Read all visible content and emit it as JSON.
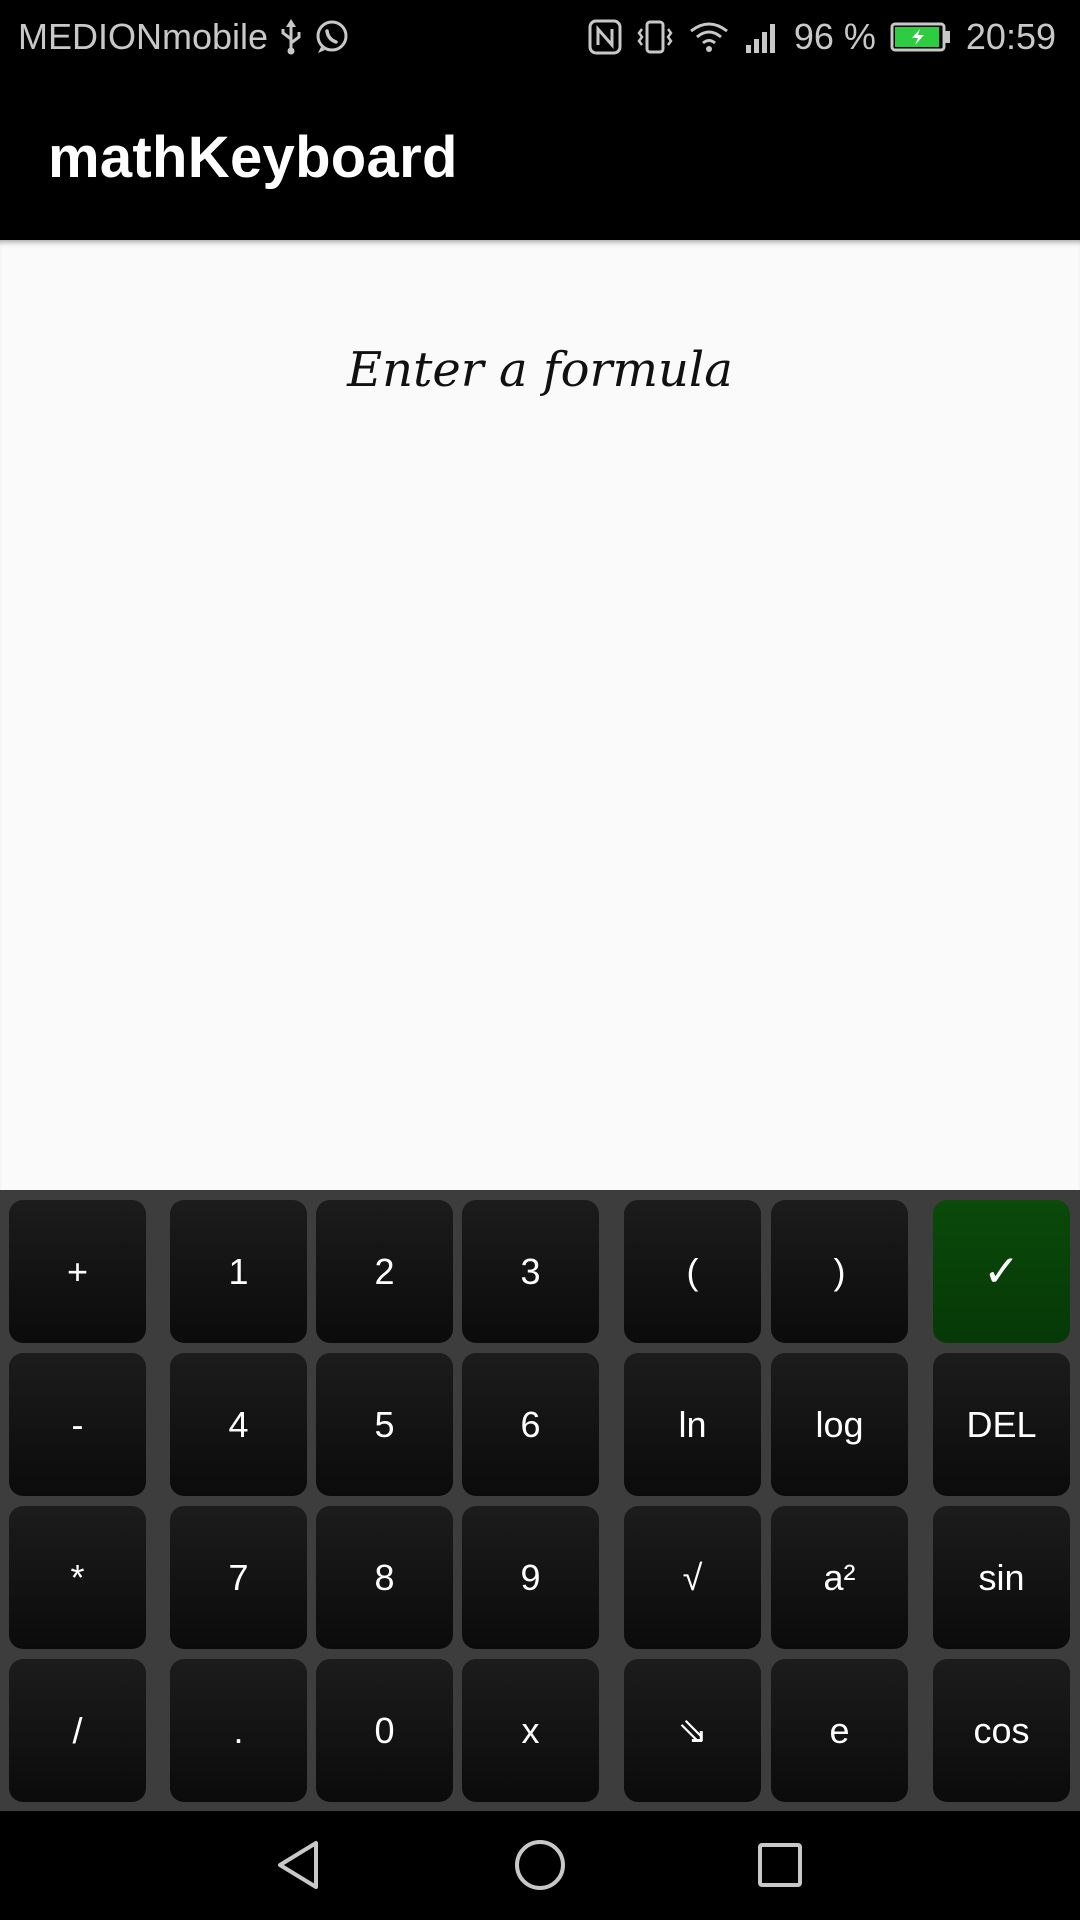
{
  "status_bar": {
    "carrier": "MEDIONmobile",
    "battery_percent": "96 %",
    "time": "20:59",
    "battery_level": 0.96,
    "battery_color": "#2ecc40",
    "icons_left": [
      "usb-icon",
      "whatsapp-icon"
    ],
    "icons_right": [
      "nfc-icon",
      "vibrate-icon",
      "wifi-icon",
      "signal-icon",
      "battery-icon"
    ]
  },
  "app_bar": {
    "title": "mathKeyboard"
  },
  "content": {
    "placeholder": "Enter a formula"
  },
  "keyboard": {
    "background": "#3d3d3d",
    "accent_color": "#063806",
    "rows": [
      [
        "+",
        "1",
        "2",
        "3",
        "(",
        ")",
        "✓"
      ],
      [
        "-",
        "4",
        "5",
        "6",
        "ln",
        "log",
        "DEL"
      ],
      [
        "*",
        "7",
        "8",
        "9",
        "√",
        "a²",
        "sin"
      ],
      [
        "/",
        ".",
        "0",
        "x",
        "⇘",
        "e",
        "cos"
      ]
    ]
  },
  "nav_bar": {
    "buttons": [
      "back-icon",
      "home-icon",
      "recents-icon"
    ]
  }
}
